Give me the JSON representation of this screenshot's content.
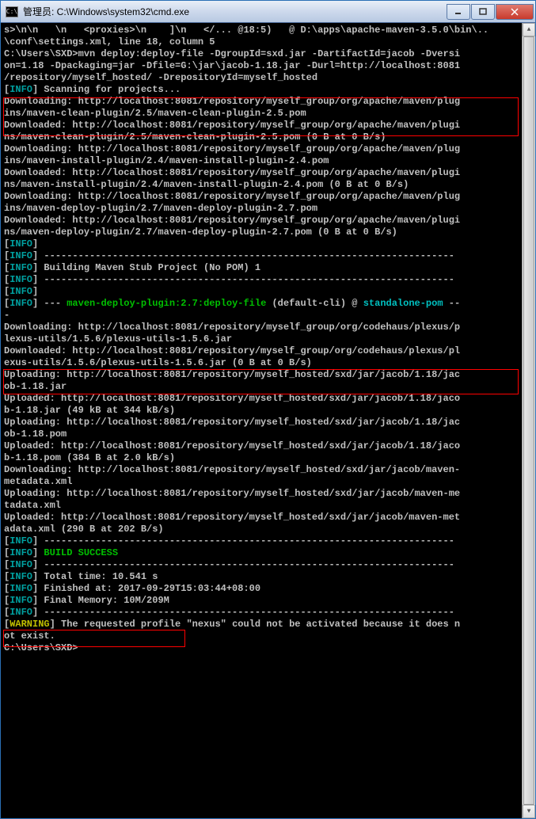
{
  "window": {
    "title": "管理员: C:\\Windows\\system32\\cmd.exe",
    "icon_text": "C:\\"
  },
  "term": {
    "l01": "s>\\n\\n   \\n   <proxies>\\n    ]\\n   </... @18:5)   @ D:\\apps\\apache-maven-3.5.0\\bin\\..",
    "l02": "\\conf\\settings.xml, line 18, column 5",
    "l03": "",
    "l04": "",
    "l05": "C:\\Users\\SXD>mvn deploy:deploy-file -DgroupId=sxd.jar -DartifactId=jacob -Dversi",
    "l06": "on=1.18 -Dpackaging=jar -Dfile=G:\\jar\\jacob-1.18.jar -Durl=http://localhost:8081",
    "l07": "/repository/myself_hosted/ -DrepositoryId=myself_hosted",
    "l08a": "[",
    "l08b": "INFO",
    "l08c": "] Scanning for projects...",
    "l09": "Downloading: http://localhost:8081/repository/myself_group/org/apache/maven/plug",
    "l10": "ins/maven-clean-plugin/2.5/maven-clean-plugin-2.5.pom",
    "l11": "Downloaded: http://localhost:8081/repository/myself_group/org/apache/maven/plugi",
    "l12": "ns/maven-clean-plugin/2.5/maven-clean-plugin-2.5.pom (0 B at 0 B/s)",
    "l13": "Downloading: http://localhost:8081/repository/myself_group/org/apache/maven/plug",
    "l14": "ins/maven-install-plugin/2.4/maven-install-plugin-2.4.pom",
    "l15": "Downloaded: http://localhost:8081/repository/myself_group/org/apache/maven/plugi",
    "l16": "ns/maven-install-plugin/2.4/maven-install-plugin-2.4.pom (0 B at 0 B/s)",
    "l17": "Downloading: http://localhost:8081/repository/myself_group/org/apache/maven/plug",
    "l18": "ins/maven-deploy-plugin/2.7/maven-deploy-plugin-2.7.pom",
    "l19": "Downloaded: http://localhost:8081/repository/myself_group/org/apache/maven/plugi",
    "l20": "ns/maven-deploy-plugin/2.7/maven-deploy-plugin-2.7.pom (0 B at 0 B/s)",
    "l21a": "[",
    "l21b": "INFO",
    "l21c": "]",
    "l22a": "[",
    "l22b": "INFO",
    "l22c": "] ------------------------------------------------------------------------",
    "l23a": "[",
    "l23b": "INFO",
    "l23c": "] ",
    "l23d": "Building Maven Stub Project (No POM) 1",
    "l24a": "[",
    "l24b": "INFO",
    "l24c": "] ------------------------------------------------------------------------",
    "l25a": "[",
    "l25b": "INFO",
    "l25c": "]",
    "l26a": "[",
    "l26b": "INFO",
    "l26c": "] ",
    "l26d": "--- ",
    "l26e": "maven-deploy-plugin:2.7:deploy-file",
    "l26f": " (default-cli)",
    "l26g": " @ ",
    "l26h": "standalone-pom",
    "l26i": " --",
    "l27": "-",
    "l28": "Downloading: http://localhost:8081/repository/myself_group/org/codehaus/plexus/p",
    "l29": "lexus-utils/1.5.6/plexus-utils-1.5.6.jar",
    "l30": "Downloaded: http://localhost:8081/repository/myself_group/org/codehaus/plexus/pl",
    "l31": "exus-utils/1.5.6/plexus-utils-1.5.6.jar (0 B at 0 B/s)",
    "l32": "Uploading: http://localhost:8081/repository/myself_hosted/sxd/jar/jacob/1.18/jac",
    "l33": "ob-1.18.jar",
    "l34": "Uploaded: http://localhost:8081/repository/myself_hosted/sxd/jar/jacob/1.18/jaco",
    "l35": "b-1.18.jar (49 kB at 344 kB/s)",
    "l36": "Uploading: http://localhost:8081/repository/myself_hosted/sxd/jar/jacob/1.18/jac",
    "l37": "ob-1.18.pom",
    "l38": "Uploaded: http://localhost:8081/repository/myself_hosted/sxd/jar/jacob/1.18/jaco",
    "l39": "b-1.18.pom (384 B at 2.0 kB/s)",
    "l40": "Downloading: http://localhost:8081/repository/myself_hosted/sxd/jar/jacob/maven-",
    "l41": "metadata.xml",
    "l42": "Uploading: http://localhost:8081/repository/myself_hosted/sxd/jar/jacob/maven-me",
    "l43": "tadata.xml",
    "l44": "Uploaded: http://localhost:8081/repository/myself_hosted/sxd/jar/jacob/maven-met",
    "l45": "adata.xml (290 B at 202 B/s)",
    "l46a": "[",
    "l46b": "INFO",
    "l46c": "] ------------------------------------------------------------------------",
    "l47a": "[",
    "l47b": "INFO",
    "l47c": "] ",
    "l47d": "BUILD SUCCESS",
    "l48a": "[",
    "l48b": "INFO",
    "l48c": "] ------------------------------------------------------------------------",
    "l49a": "[",
    "l49b": "INFO",
    "l49c": "] Total time: 10.541 s",
    "l50a": "[",
    "l50b": "INFO",
    "l50c": "] Finished at: 2017-09-29T15:03:44+08:00",
    "l51a": "[",
    "l51b": "INFO",
    "l51c": "] Final Memory: 10M/209M",
    "l52a": "[",
    "l52b": "INFO",
    "l52c": "] ------------------------------------------------------------------------",
    "l53a": "[",
    "l53b": "WARNING",
    "l53c": "] The requested profile \"nexus\" could not be activated because it does n",
    "l54": "ot exist.",
    "l55": "",
    "l56": "C:\\Users\\SXD>"
  }
}
